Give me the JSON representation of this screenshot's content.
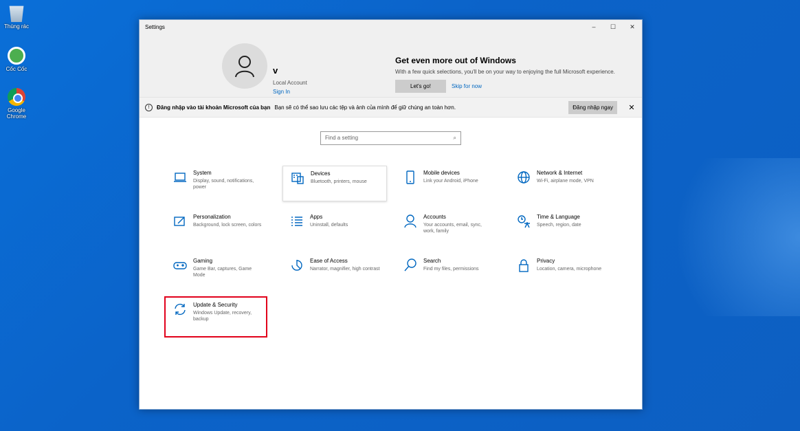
{
  "desktop": {
    "icons": [
      {
        "label": "Thùng rác"
      },
      {
        "label": "Cốc Cốc"
      },
      {
        "label": "Google Chrome"
      }
    ]
  },
  "window": {
    "title": "Settings",
    "controls": {
      "minimize": "–",
      "maximize": "☐",
      "close": "✕"
    }
  },
  "user": {
    "name": "v",
    "account_type": "Local Account",
    "sign_in": "Sign In"
  },
  "promo": {
    "title": "Get even more out of Windows",
    "text": "With a few quick selections, you'll be on your way to enjoying the full Microsoft experience.",
    "go_label": "Let's go!",
    "skip_label": "Skip for now"
  },
  "notice": {
    "bold": "Đăng nhập vào tài khoản Microsoft của bạn",
    "text": "Bạn sẽ có thể sao lưu các tệp và ảnh của mình để giữ chúng an toàn hơn.",
    "button": "Đăng nhập ngay",
    "close": "✕"
  },
  "search": {
    "placeholder": "Find a setting",
    "icon": "⌕"
  },
  "categories": [
    {
      "name": "System",
      "desc": "Display, sound, notifications, power",
      "icon": "laptop-icon"
    },
    {
      "name": "Devices",
      "desc": "Bluetooth, printers, mouse",
      "icon": "keyboard-icon"
    },
    {
      "name": "Mobile devices",
      "desc": "Link your Android, iPhone",
      "icon": "phone-icon"
    },
    {
      "name": "Network & Internet",
      "desc": "Wi-Fi, airplane mode, VPN",
      "icon": "globe-icon"
    },
    {
      "name": "Personalization",
      "desc": "Background, lock screen, colors",
      "icon": "brush-icon"
    },
    {
      "name": "Apps",
      "desc": "Uninstall, defaults",
      "icon": "list-icon"
    },
    {
      "name": "Accounts",
      "desc": "Your accounts, email, sync, work, family",
      "icon": "person-icon"
    },
    {
      "name": "Time & Language",
      "desc": "Speech, region, date",
      "icon": "time-language-icon"
    },
    {
      "name": "Gaming",
      "desc": "Game Bar, captures, Game Mode",
      "icon": "gamepad-icon"
    },
    {
      "name": "Ease of Access",
      "desc": "Narrator, magnifier, high contrast",
      "icon": "ease-icon"
    },
    {
      "name": "Search",
      "desc": "Find my files, permissions",
      "icon": "search-icon"
    },
    {
      "name": "Privacy",
      "desc": "Location, camera, microphone",
      "icon": "lock-icon"
    },
    {
      "name": "Update & Security",
      "desc": "Windows Update, recovery, backup",
      "icon": "sync-icon"
    }
  ],
  "colors": {
    "accent": "#0067c0",
    "highlight": "#e1001a",
    "desktop": "#0b63c9"
  }
}
